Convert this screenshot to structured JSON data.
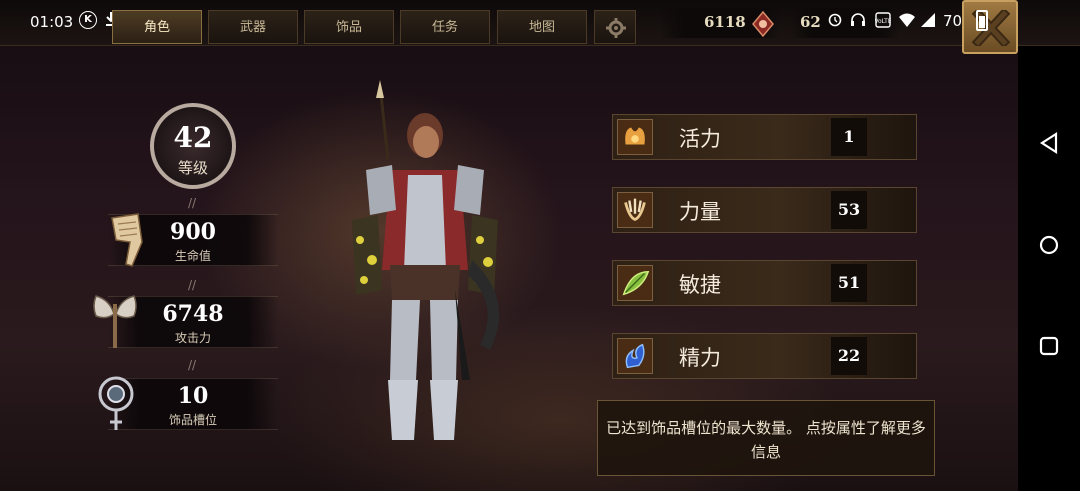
{
  "status_bar": {
    "time": "01:03",
    "battery": "70%"
  },
  "tabs": [
    {
      "label": "角色",
      "active": true
    },
    {
      "label": "武器",
      "active": false
    },
    {
      "label": "饰品",
      "active": false
    },
    {
      "label": "任务",
      "active": false
    },
    {
      "label": "地图",
      "active": false
    }
  ],
  "currency": {
    "gold": "6118",
    "second": "62"
  },
  "character": {
    "level": "42",
    "level_label": "等级",
    "stats": [
      {
        "value": "900",
        "label": "生命值",
        "icon": "health-scroll-icon"
      },
      {
        "value": "6748",
        "label": "攻击力",
        "icon": "axe-icon"
      },
      {
        "value": "10",
        "label": "饰品槽位",
        "icon": "trinket-slot-icon"
      }
    ]
  },
  "attributes": [
    {
      "name": "活力",
      "value": "1",
      "icon": "vitality-icon"
    },
    {
      "name": "力量",
      "value": "53",
      "icon": "strength-icon"
    },
    {
      "name": "敏捷",
      "value": "51",
      "icon": "agility-icon"
    },
    {
      "name": "精力",
      "value": "22",
      "icon": "energy-icon"
    }
  ],
  "info_message": "已达到饰品槽位的最大数量。 点按属性了解更多信息",
  "colors": {
    "accent_gold": "#c8a060",
    "panel_bg": "#2e2014"
  }
}
